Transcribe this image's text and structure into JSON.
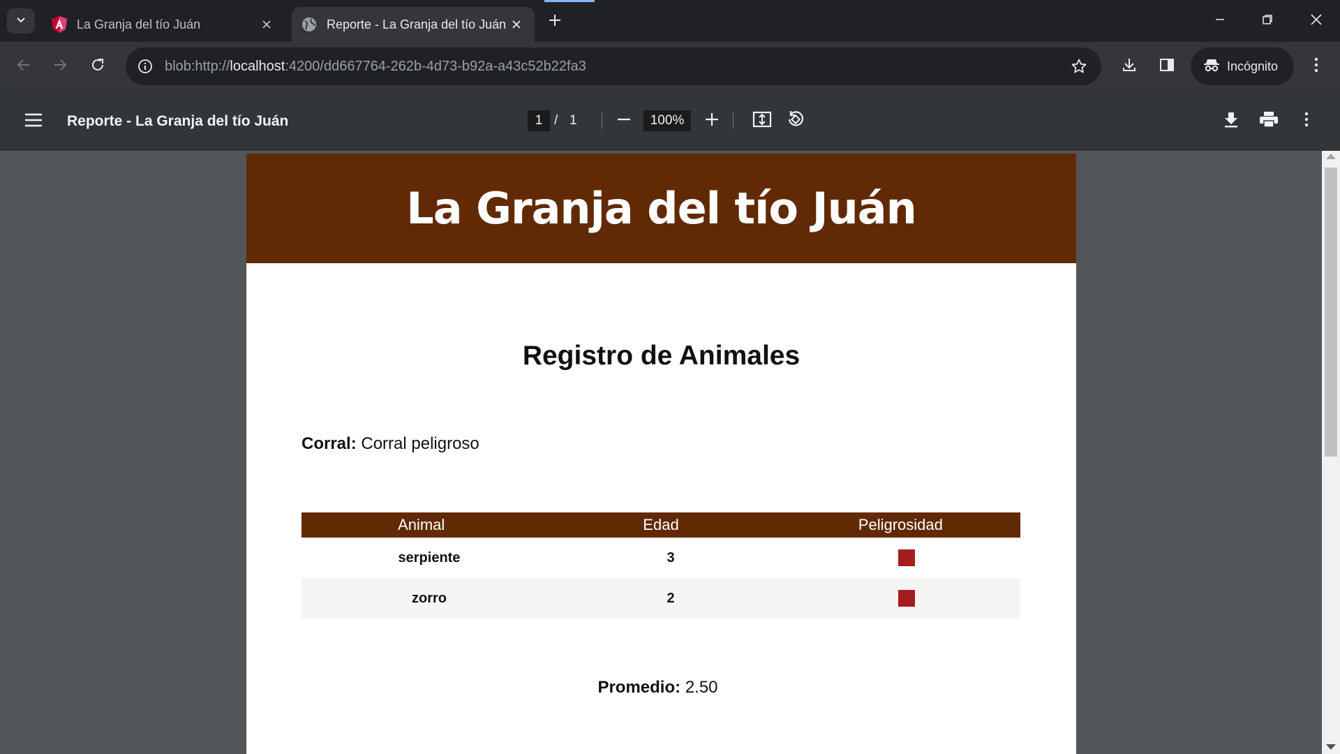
{
  "browser": {
    "tabs": [
      {
        "title": "La Granja del tío Juán",
        "favicon": "angular-icon",
        "active": false
      },
      {
        "title": "Reporte - La Granja del tío Juán",
        "favicon": "globe-icon",
        "active": true
      }
    ],
    "url_prefix": "blob:http://",
    "url_host": "localhost",
    "url_rest": ":4200/dd667764-262b-4d73-b92a-a43c52b22fa3",
    "profile_label": "Incógnito"
  },
  "pdf_viewer": {
    "title": "Reporte - La Granja del tío Juán",
    "current_page": "1",
    "page_separator": "/",
    "total_pages": "1",
    "zoom": "100%"
  },
  "document": {
    "banner_title": "La Granja del tío Juán",
    "heading": "Registro de Animales",
    "corral_label": "Corral:",
    "corral_value": "Corral peligroso",
    "table": {
      "headers": [
        "Animal",
        "Edad",
        "Peligrosidad"
      ],
      "rows": [
        {
          "animal": "serpiente",
          "edad": "3",
          "peligrosidad_color": "#a51c1c"
        },
        {
          "animal": "zorro",
          "edad": "2",
          "peligrosidad_color": "#a51c1c"
        }
      ]
    },
    "promedio_label": "Promedio:",
    "promedio_value": "2.50"
  },
  "colors": {
    "banner": "#612a05",
    "danger": "#a51c1c",
    "viewer_bg": "#525659"
  }
}
